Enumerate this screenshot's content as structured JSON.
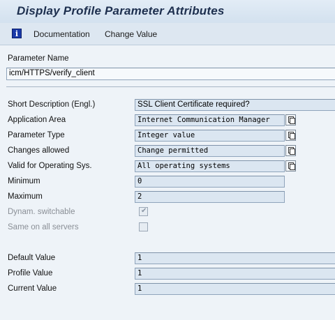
{
  "window": {
    "title": "Display Profile Parameter Attributes"
  },
  "toolbar": {
    "info_icon": "info-icon",
    "documentation_label": "Documentation",
    "change_value_label": "Change Value"
  },
  "parameter": {
    "name_label": "Parameter Name",
    "name_value": "icm/HTTPS/verify_client"
  },
  "attributes": {
    "short_desc_label": "Short Description (Engl.)",
    "short_desc_value": "SSL Client Certificate required?",
    "app_area_label": "Application Area",
    "app_area_value": "Internet Communication Manager",
    "param_type_label": "Parameter Type",
    "param_type_value": "Integer value",
    "changes_allowed_label": "Changes allowed",
    "changes_allowed_value": "Change permitted",
    "valid_os_label": "Valid for Operating Sys.",
    "valid_os_value": "All operating systems",
    "minimum_label": "Minimum",
    "minimum_value": "0",
    "maximum_label": "Maximum",
    "maximum_value": "2",
    "dynam_label": "Dynam. switchable",
    "dynam_checked": true,
    "same_label": "Same on all servers",
    "same_checked": false
  },
  "values": {
    "default_label": "Default Value",
    "default_value": "1",
    "profile_label": "Profile Value",
    "profile_value": "1",
    "current_label": "Current Value",
    "current_value": "1"
  }
}
